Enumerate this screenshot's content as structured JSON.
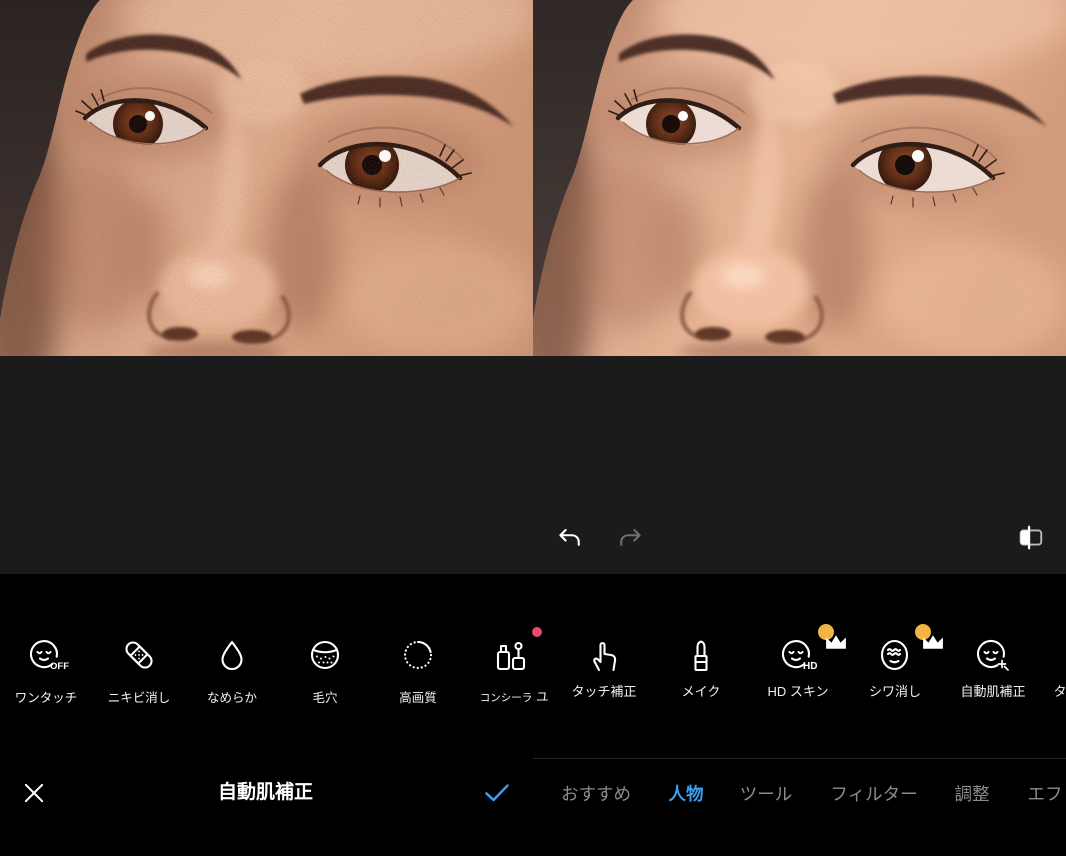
{
  "left_panel": {
    "tools": [
      {
        "label": "ワンタッチ",
        "icon": "face-off-icon",
        "icon_text": "OFF"
      },
      {
        "label": "ニキビ消し",
        "icon": "bandage-icon"
      },
      {
        "label": "なめらか",
        "icon": "droplet-icon"
      },
      {
        "label": "毛穴",
        "icon": "pore-icon"
      },
      {
        "label": "高画質",
        "icon": "hd-quality-icon"
      },
      {
        "label": "コンシーラ",
        "icon": "concealer-icon",
        "new_badge": true
      }
    ],
    "overflow_label": "ユ",
    "bottom_bar": {
      "close_icon": "close-icon",
      "title": "自動肌補正",
      "confirm_icon": "check-icon"
    }
  },
  "right_panel": {
    "history": {
      "undo_icon": "undo-icon",
      "redo_icon": "redo-icon",
      "redo_enabled": false
    },
    "compare_icon": "compare-icon",
    "tools": [
      {
        "label": "タッチ補正",
        "icon": "touch-icon"
      },
      {
        "label": "メイク",
        "icon": "lipstick-icon"
      },
      {
        "label": "HD スキン",
        "icon": "face-hd-icon",
        "icon_text": "HD",
        "premium": true
      },
      {
        "label": "シワ消し",
        "icon": "wrinkle-icon",
        "premium": true
      },
      {
        "label": "自動肌補正",
        "icon": "auto-skin-icon"
      },
      {
        "label": "タ"
      }
    ],
    "tabs": [
      {
        "label": "おすすめ",
        "active": false
      },
      {
        "label": "人物",
        "active": true
      },
      {
        "label": "ツール",
        "active": false
      },
      {
        "label": "フィルター",
        "active": false
      },
      {
        "label": "調整",
        "active": false
      },
      {
        "label": "エフ",
        "active": false
      }
    ]
  },
  "colors": {
    "accent": "#3d9ff2",
    "premium_badge": "#f2b544",
    "new_badge": "#e24d6a",
    "canvas_bg": "#1b1b1b",
    "toolbar_bg": "#000000",
    "inactive_tab": "#8c8c8c",
    "disabled_icon": "#6f6f6f"
  }
}
